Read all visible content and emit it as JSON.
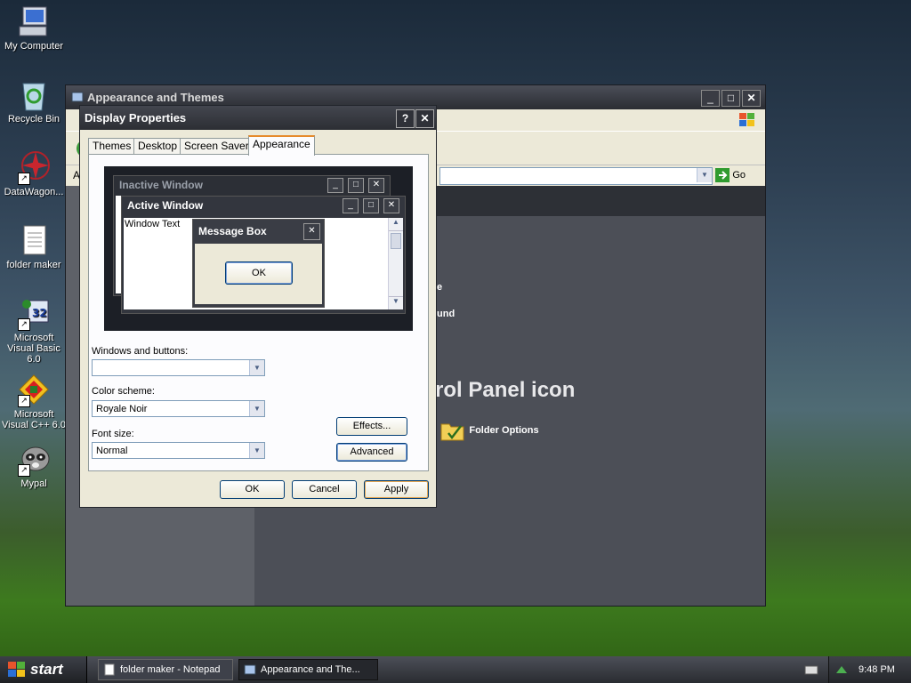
{
  "desktop": {
    "icons": [
      {
        "label": "My Computer"
      },
      {
        "label": "Recycle Bin"
      },
      {
        "label": "DataWagon..."
      },
      {
        "label": "folder maker"
      },
      {
        "label": "Microsoft Visual Basic 6.0"
      },
      {
        "label": "Microsoft Visual C++ 6.0"
      },
      {
        "label": "Mypal"
      }
    ]
  },
  "control_panel": {
    "title": "Appearance and Themes",
    "address_prefix": "A",
    "go_label": "Go",
    "partial_items": [
      "e",
      "und"
    ],
    "heading_partial": "rol Panel icon",
    "folder_options_label": "Folder Options"
  },
  "display_properties": {
    "title": "Display Properties",
    "help_label": "?",
    "close_label": "✕",
    "tabs": [
      "Themes",
      "Desktop",
      "Screen Saver",
      "Appearance"
    ],
    "selected_tab": "Appearance",
    "preview": {
      "inactive_title": "Inactive Window",
      "active_title": "Active Window",
      "window_text": "Window Text",
      "message_title": "Message Box",
      "ok_label": "OK"
    },
    "windows_buttons_label": "Windows and buttons:",
    "windows_buttons_value": "",
    "color_scheme_label": "Color scheme:",
    "color_scheme_value": "Royale Noir",
    "font_size_label": "Font size:",
    "font_size_value": "Normal",
    "effects_label": "Effects...",
    "advanced_label": "Advanced",
    "ok_label": "OK",
    "cancel_label": "Cancel",
    "apply_label": "Apply"
  },
  "taskbar": {
    "start_label": "start",
    "tasks": [
      {
        "label": "folder maker - Notepad"
      },
      {
        "label": "Appearance and The..."
      }
    ],
    "clock": "9:48 PM"
  },
  "colors": {
    "accent_orange": "#e68b2c",
    "xp_blue_border": "#003c74"
  }
}
